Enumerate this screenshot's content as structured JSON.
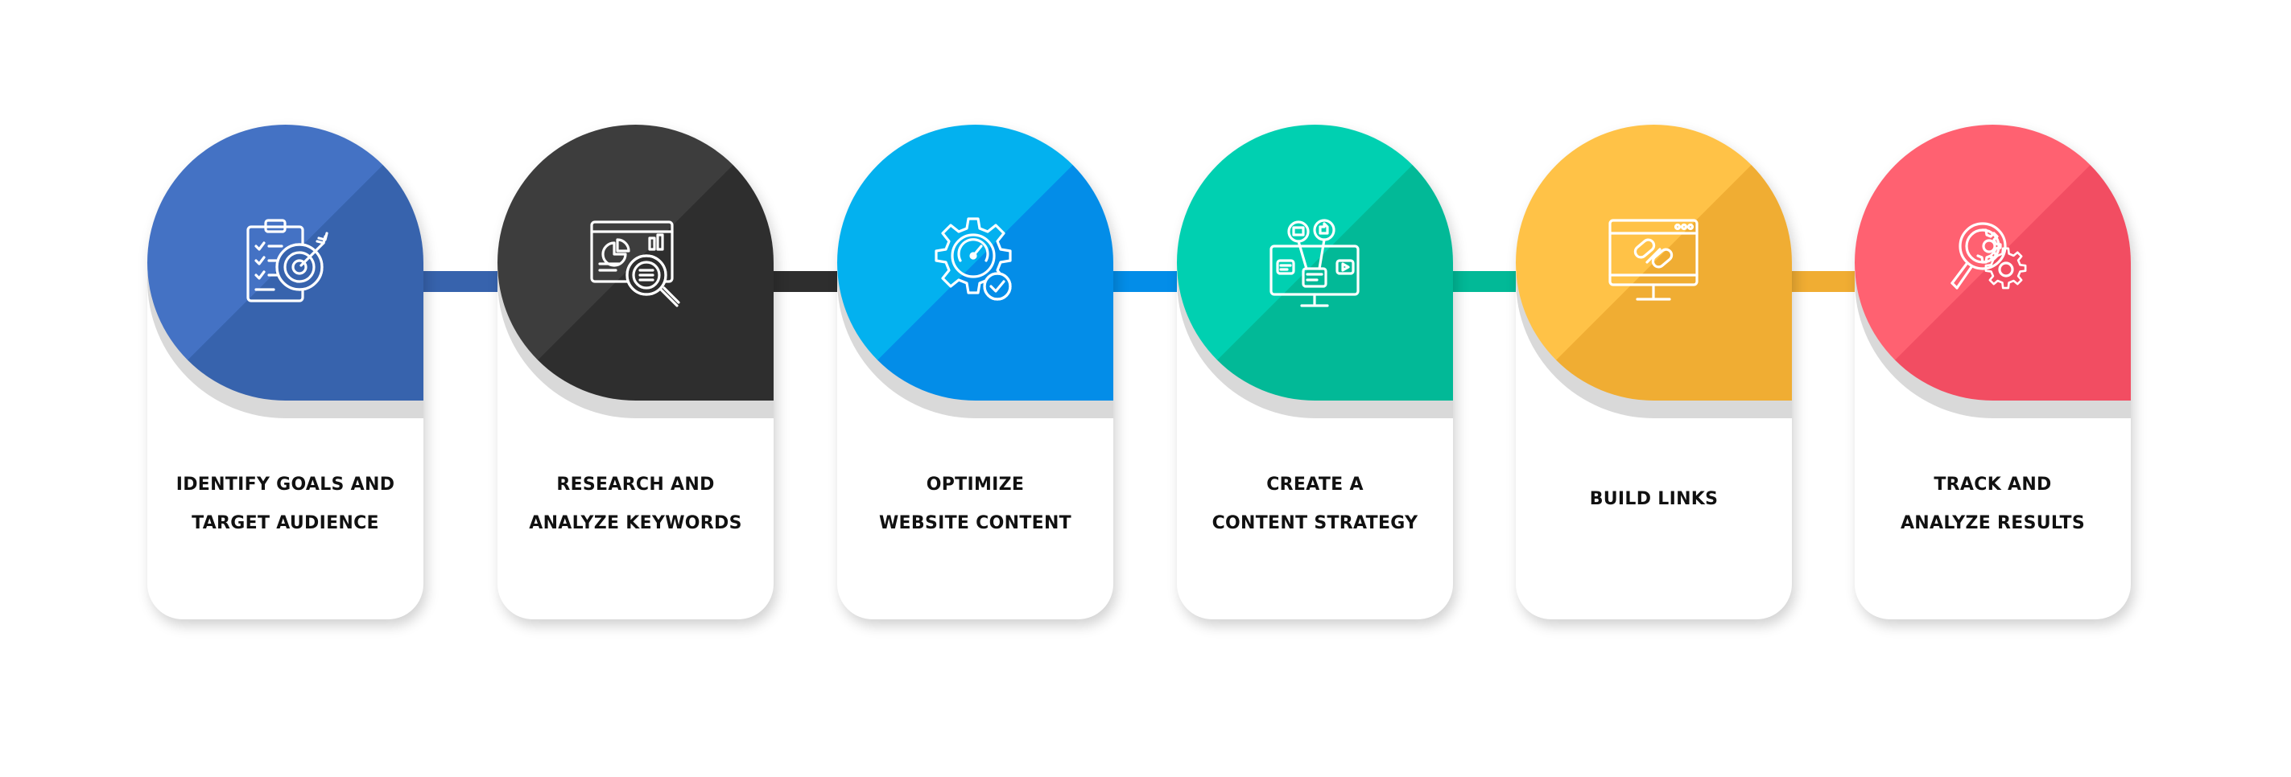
{
  "diagram": {
    "steps": [
      {
        "lines": [
          "IDENTIFY GOALS AND",
          "TARGET AUDIENCE"
        ],
        "icon": "goal-clipboard-target-icon",
        "color_light": "#4472c4",
        "color_dark": "#3763ad"
      },
      {
        "lines": [
          "RESEARCH AND",
          "ANALYZE KEYWORDS"
        ],
        "icon": "keyword-research-magnifier-icon",
        "color_light": "#3d3d3d",
        "color_dark": "#2e2e2e"
      },
      {
        "lines": [
          "OPTIMIZE",
          "WEBSITE CONTENT"
        ],
        "icon": "optimization-gear-gauge-icon",
        "color_light": "#03b1ef",
        "color_dark": "#038de8"
      },
      {
        "lines": [
          "CREATE A",
          "CONTENT STRATEGY"
        ],
        "icon": "content-strategy-monitor-icon",
        "color_light": "#00d0b1",
        "color_dark": "#02b997"
      },
      {
        "lines": [
          "BUILD LINKS"
        ],
        "icon": "link-building-monitor-icon",
        "color_light": "#ffc247",
        "color_dark": "#f0ad33"
      },
      {
        "lines": [
          "TRACK AND",
          "ANALYZE RESULTS"
        ],
        "icon": "analytics-magnifier-gears-icon",
        "color_light": "#ff6171",
        "color_dark": "#f24d62"
      }
    ]
  }
}
